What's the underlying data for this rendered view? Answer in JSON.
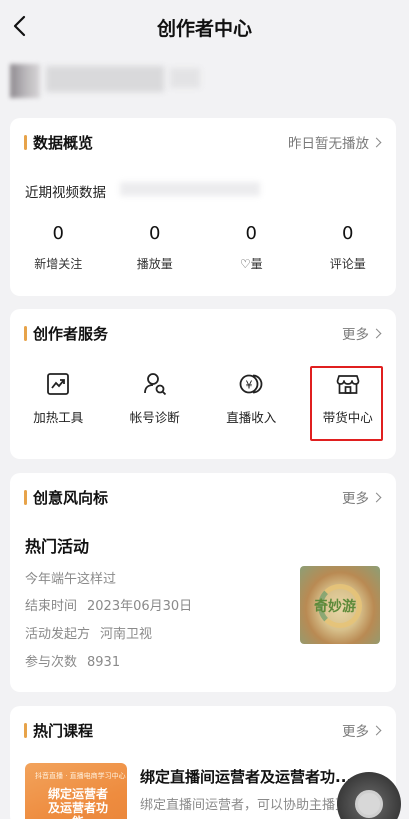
{
  "header": {
    "title": "创作者中心"
  },
  "data_overview": {
    "title": "数据概览",
    "status": "昨日暂无播放",
    "recent_label": "近期视频数据",
    "stats": [
      {
        "value": "0",
        "label": "新增关注"
      },
      {
        "value": "0",
        "label": "播放量"
      },
      {
        "value": "0",
        "label": "♡量"
      },
      {
        "value": "0",
        "label": "评论量"
      }
    ]
  },
  "services": {
    "title": "创作者服务",
    "more": "更多",
    "items": [
      {
        "label": "加热工具",
        "icon": "trend-chart-icon"
      },
      {
        "label": "帐号诊断",
        "icon": "user-search-icon"
      },
      {
        "label": "直播收入",
        "icon": "yuan-coin-icon"
      },
      {
        "label": "带货中心",
        "icon": "store-icon"
      }
    ]
  },
  "creative": {
    "title": "创意风向标",
    "more": "更多",
    "activity_title": "热门活动",
    "activity_name": "今年端午这样过",
    "end_time_label": "结束时间",
    "end_time": "2023年06月30日",
    "publisher_label": "活动发起方",
    "publisher": "河南卫视",
    "participants_label": "参与次数",
    "participants": "8931",
    "thumb_text": "奇妙游"
  },
  "courses": {
    "title": "热门课程",
    "more": "更多",
    "course_title": "绑定直播间运营者及运营者功...",
    "course_desc": "绑定直播间运营者，可以协助主播更",
    "thumb_small": "抖音直播 · 直播电商学习中心",
    "thumb_big": "绑定运营者及运营者功能"
  }
}
